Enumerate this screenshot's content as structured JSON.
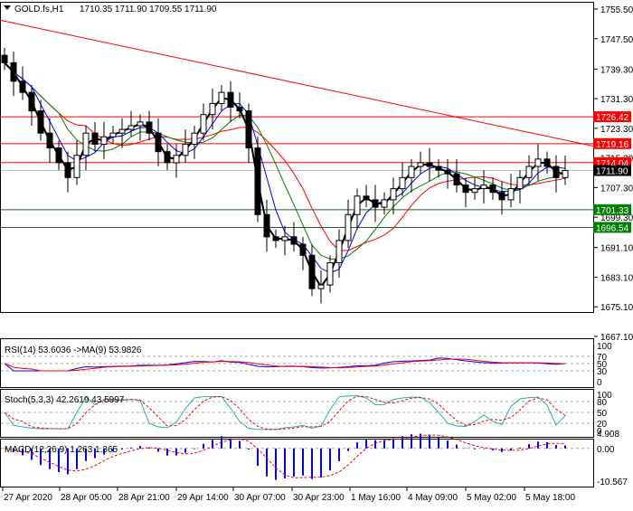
{
  "header": {
    "symbol": "GOLD.fs,H1",
    "ohlc": "1710.35 1711.90 1709.55 1711.90"
  },
  "price_axis": [
    "1755.50",
    "1747.50",
    "1739.30",
    "1731.30",
    "1723.30",
    "1715.30",
    "1707.30",
    "1699.30",
    "1691.10",
    "1683.10",
    "1675.10",
    "1667.10"
  ],
  "levels": [
    {
      "value": "1726.42",
      "color": "#ff0000"
    },
    {
      "value": "1719.16",
      "color": "#ff0000"
    },
    {
      "value": "1714.04",
      "color": "#ff0000"
    },
    {
      "value": "1711.90",
      "color": "#000000"
    },
    {
      "value": "1701.33",
      "color": "#008000"
    },
    {
      "value": "1696.54",
      "color": "#008000"
    }
  ],
  "indicators": {
    "rsi": {
      "title": "RSI(14) 53.6036  ->MA(9) 53.9826",
      "ticks": [
        "100",
        "70",
        "50",
        "30",
        "0"
      ]
    },
    "stoch": {
      "title": "Stoch(5,3,3) 42.2619 43.5997",
      "ticks": [
        "100",
        "80",
        "50",
        "20",
        "0"
      ]
    },
    "macd": {
      "title": "MACD(12,26,9) 1.263 1.365",
      "ticks": [
        "4.908",
        "0.00",
        "-10.567"
      ]
    }
  },
  "time_axis": [
    "27 Apr 2020",
    "28 Apr 05:00",
    "28 Apr 21:00",
    "29 Apr 14:00",
    "30 Apr 07:00",
    "30 Apr 23:00",
    "1 May 16:00",
    "4 May 09:00",
    "5 May 02:00",
    "5 May 18:00"
  ],
  "chart_data": {
    "type": "candlestick",
    "title": "GOLD.fs,H1",
    "ylim": [
      1667.1,
      1755.5
    ],
    "closes": [
      1741,
      1736,
      1733,
      1728,
      1722,
      1718,
      1714,
      1710,
      1716,
      1722,
      1719,
      1721,
      1722,
      1723,
      1724,
      1725,
      1722,
      1717,
      1714,
      1716,
      1719,
      1722,
      1727,
      1730,
      1733,
      1729,
      1728,
      1718,
      1700,
      1694,
      1693,
      1694,
      1692,
      1689,
      1680,
      1681,
      1687,
      1693,
      1700,
      1705,
      1704,
      1702,
      1704,
      1707,
      1710,
      1713,
      1714,
      1713,
      1712,
      1711,
      1708,
      1706,
      1707,
      1708,
      1706,
      1704,
      1707,
      1710,
      1713,
      1715,
      1713,
      1710,
      1711.9
    ],
    "trendline": [
      1752.5,
      1718.5
    ],
    "ma_colors": {
      "fast": "#000000",
      "mid": "#0000ff",
      "slow": "#008000",
      "long": "#ff0000"
    }
  }
}
